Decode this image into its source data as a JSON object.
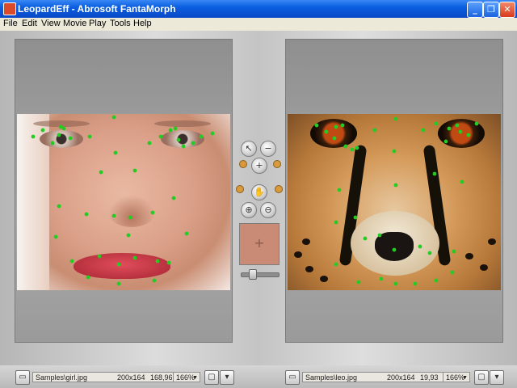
{
  "window": {
    "title": "LeopardEff - Abrosoft FantaMorph"
  },
  "menu": [
    "File",
    "Edit",
    "View",
    "Movie",
    "Play",
    "Tools",
    "Help"
  ],
  "colors": {
    "titlebar": "#0a5fe0",
    "keypoint": "#22cc22",
    "preview": "#c98a76"
  },
  "icons": {
    "title_buttons": [
      "minimize-icon",
      "maximize-icon",
      "close-icon"
    ],
    "tools": [
      "pointer-icon",
      "remove-point-icon",
      "add-point-icon",
      "hand-icon",
      "zoom-in-icon",
      "zoom-out-icon"
    ]
  },
  "left_image": {
    "path": "Samples\\girl.jpg",
    "size": "200x164",
    "coords": "168,96",
    "zoom": "166%"
  },
  "right_image": {
    "path": "Samples\\leo.jpg",
    "size": "200x164",
    "coords": "19,93",
    "zoom": "166%"
  },
  "glyphs": {
    "min": "_",
    "max": "❐",
    "close": "✕",
    "pointer": "↖",
    "remove": "−",
    "add": "+",
    "hand": "✋",
    "zoomin": "⊕",
    "zoomout": "⊖",
    "crosshair": "+",
    "caret": "▼",
    "open": "▭",
    "fit": "▢",
    "menu": "▾"
  }
}
